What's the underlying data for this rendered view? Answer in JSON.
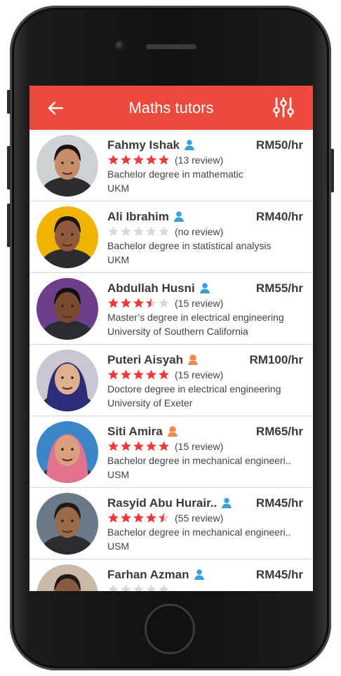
{
  "header": {
    "title": "Maths tutors",
    "back_icon": "arrow-left-icon",
    "filter_icon": "sliders-icon",
    "color": "#ec4a3c"
  },
  "tutors": [
    {
      "name": "Fahmy Ishak",
      "gender": "male",
      "price": "RM50/hr",
      "rating": 5,
      "reviews": "(13 review)",
      "degree": "Bachelor degree in mathematic",
      "university": "UKM"
    },
    {
      "name": "Ali Ibrahim",
      "gender": "male",
      "price": "RM40/hr",
      "rating": 0,
      "reviews": "(no review)",
      "degree": "Bachelor degree in statistical analysis",
      "university": "UKM"
    },
    {
      "name": "Abdullah Husni",
      "gender": "male",
      "price": "RM55/hr",
      "rating": 3.5,
      "reviews": "(15 review)",
      "degree": "Master’s degree in electrical engineering",
      "university": "University of Southern California"
    },
    {
      "name": "Puteri Aisyah",
      "gender": "female",
      "price": "RM100/hr",
      "rating": 5,
      "reviews": "(15 review)",
      "degree": "Doctore degree in electrical engineering",
      "university": "University of Exeter"
    },
    {
      "name": "Siti Amira",
      "gender": "female",
      "price": "RM65/hr",
      "rating": 5,
      "reviews": "(15 review)",
      "degree": "Bachelor degree in mechanical engineeri..",
      "university": "USM"
    },
    {
      "name": "Rasyid Abu Hurair..",
      "gender": "male",
      "price": "RM45/hr",
      "rating": 4.5,
      "reviews": "(55 review)",
      "degree": "Bachelor degree in mechanical engineeri..",
      "university": "USM"
    },
    {
      "name": "Farhan Azman",
      "gender": "male",
      "price": "RM45/hr",
      "rating": 0,
      "reviews": "",
      "degree": "",
      "university": ""
    }
  ],
  "colors": {
    "star_on": "#ec3a3a",
    "star_off": "#d9d9d9",
    "male": "#3aa0d8",
    "female": "#f08a4b"
  }
}
